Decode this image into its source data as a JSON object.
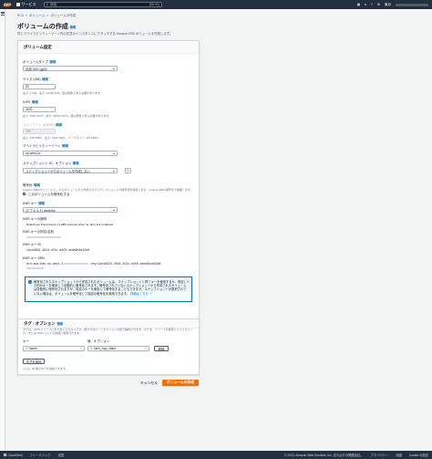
{
  "topnav": {
    "logo": "aws",
    "services_label": "サービス",
    "search_placeholder": "検索",
    "search_hint": "[Alt+S]",
    "region_label": "東京"
  },
  "breadcrumb": {
    "ec2": "EC2",
    "volumes": "ボリューム",
    "current": "ボリュームの作成",
    "sep": ">"
  },
  "page": {
    "title": "ボリュームの作成",
    "title_info": "情報",
    "description": "同じアベイラビリティーゾーン内の任意のインスタンスにアタッチする Amazon EBS ボリュームを作成します。"
  },
  "settings": {
    "header": "ボリューム設定",
    "volume_type_label": "ボリュームタイプ",
    "volume_type_info": "情報",
    "volume_type_value": "汎用 SSD (gp3)",
    "size_label": "サイズ (GiB)",
    "size_info": "情報",
    "size_value": "50",
    "size_help": "最小: 1 GiB、最大: 16384 GiB。値は整数である必要があります。",
    "iops_label": "IOPS",
    "iops_info": "情報",
    "iops_value": "3000",
    "iops_help": "最小: 3000 IOPS、最大: 16000 IOPS。値は整数である必要があります。",
    "throughput_label": "スループット (MiB/秒)",
    "throughput_info": "情報",
    "throughput_value": "250",
    "throughput_help": "最小: 125 MiB/s、最大: 1000 MiB/s、ベースライン: 125 MiB/s。",
    "az_label": "アベイラビリティーゾーン",
    "az_info": "情報",
    "az_value": "us-west-2c",
    "snapshot_label": "スナップショット ID - オプション",
    "snapshot_info": "情報",
    "snapshot_value": "スナップショットからボリュームを作成しない",
    "encryption_label": "暗号化",
    "encryption_info": "情報",
    "encryption_help": "Amazon EBS ボリュームと、そのボリュームから作成されたスナップショットの暗号化を使用します。Amazon EBS 暗号化で保護します。",
    "encrypt_checkbox_label": "このボリュームを暗号化する",
    "kms_key_label": "KMS キー",
    "kms_key_info": "情報",
    "kms_key_value": "(デフォルト) aws/ebs",
    "kms_desc_label": "KMS キーの説明",
    "kms_desc_value": "Default key that protects my EBS volumes when no other key is defined",
    "kms_alias_label": "KMS キーの別名/名前",
    "kms_id_label": "KMS キー ID",
    "kms_id_value": "1dc4d623-4024-4f2c-a4f8-dede9b4d42e8",
    "kms_arn_label": "KMS キー ARN",
    "kms_arn_value": "arn:aws:kms:us-west-2:",
    "kms_arn_suffix": ":key/1dc4d623-4024-4f2c-a4f8-dede9b4d42e8",
    "alert_text": "暗号化されたスナップショットから作成されたボリュームは、スナップショットと同じキーを使用するか、指定した別のキーを使用して自動的に暗号化されます。暗号化されていないスナップショットから作成されたボリュームは自動的に暗号化されますが、特定のキーを使用して暗号化することもできます。スナップショットが選択されていない場合は、ボリュームを暗号化して独自の暗号化を使用できます。",
    "alert_link": "詳細はこちら"
  },
  "tags": {
    "header": "タグ - オプション",
    "header_info": "情報",
    "description": "タグは、AWS リソースに割り当てるラベルです。各タグはキーとオプションの値で構成されます。タグは、リソースの検索とフィルタリング、または AWS コストの追跡に使用できます。",
    "key_label": "キー",
    "value_label": "値 - オプション",
    "key_value": "Name",
    "value_value": "New_App_Main",
    "remove_label": "削除",
    "add_label": "タグを追加",
    "limit_help": "さらに 49 個のタグを追加できます。",
    "clear_symbol": "×"
  },
  "actions": {
    "cancel": "キャンセル",
    "create": "ボリュームの作成"
  },
  "footer": {
    "cloudshell": "CloudShell",
    "feedback": "フィードバック",
    "language": "言語",
    "copyright": "© 2023, Amazon Web Services, Inc. またはその関連会社。",
    "privacy": "プライバシー",
    "terms": "用語",
    "cookie": "Cookie の設定"
  },
  "colors": {
    "nav": "#232f3e",
    "primary": "#ec7211",
    "link": "#0073bb"
  }
}
